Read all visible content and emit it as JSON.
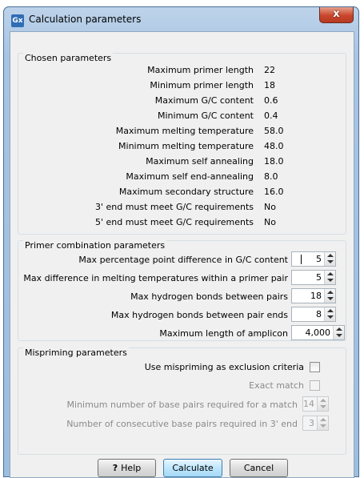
{
  "window": {
    "title": "Calculation parameters",
    "icon_text": "Gx",
    "close_glyph": "x"
  },
  "chosen": {
    "title": "Chosen parameters",
    "rows": [
      {
        "label": "Maximum primer length",
        "value": "22"
      },
      {
        "label": "Minimum primer length",
        "value": "18"
      },
      {
        "label": "Maximum G/C content",
        "value": "0.6"
      },
      {
        "label": "Minimum G/C content",
        "value": "0.4"
      },
      {
        "label": "Maximum melting temperature",
        "value": "58.0"
      },
      {
        "label": "Minimum melting temperature",
        "value": "48.0"
      },
      {
        "label": "Maximum self annealing",
        "value": "18.0"
      },
      {
        "label": "Maximum self end-annealing",
        "value": "8.0"
      },
      {
        "label": "Maximum secondary structure",
        "value": "16.0"
      },
      {
        "label": "3' end must meet G/C requirements",
        "value": "No"
      },
      {
        "label": "5' end must meet G/C requirements",
        "value": "No"
      }
    ]
  },
  "combo": {
    "title": "Primer combination parameters",
    "fields": [
      {
        "label": "Max percentage point difference in G/C content",
        "value": "5"
      },
      {
        "label": "Max difference in melting temperatures within a primer pair",
        "value": "5"
      },
      {
        "label": "Max hydrogen bonds between pairs",
        "value": "18"
      },
      {
        "label": "Max hydrogen bonds between pair ends",
        "value": "8"
      },
      {
        "label": "Maximum length of amplicon",
        "value": "4,000"
      }
    ]
  },
  "mis": {
    "title": "Mispriming parameters",
    "use_label": "Use mispriming as exclusion criteria",
    "use_checked": false,
    "exact_label": "Exact match",
    "exact_checked": false,
    "min_pairs_label": "Minimum number of base pairs required for a match",
    "min_pairs_value": "14",
    "consec_label": "Number of consecutive base pairs required in 3' end",
    "consec_value": "3"
  },
  "buttons": {
    "help_icon": "?",
    "help": "Help",
    "calculate": "Calculate",
    "cancel": "Cancel"
  }
}
